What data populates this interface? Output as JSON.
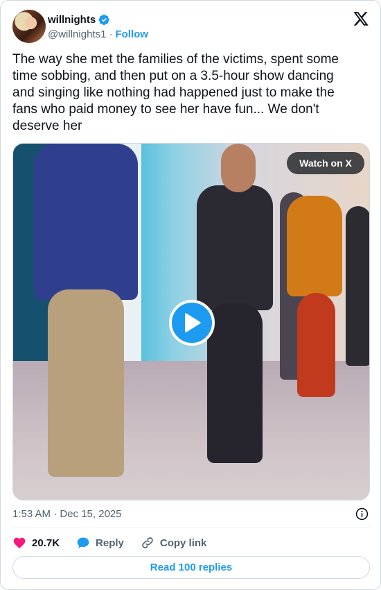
{
  "author": {
    "name": "willnights",
    "handle": "@willnights1",
    "separator": "·",
    "follow_label": "Follow"
  },
  "tweet": {
    "text": "The way she met the families of the victims, spent some time sobbing, and then put on a 3.5-hour show dancing and singing like nothing had happened just to make the fans who paid money to see her have fun... We don't deserve her",
    "timestamp": "1:53 AM · Dec 15, 2025"
  },
  "media": {
    "watch_label": "Watch on X",
    "play_icon": "play-icon"
  },
  "actions": {
    "likes_count": "20.7K",
    "reply_label": "Reply",
    "copy_link_label": "Copy link"
  },
  "read_replies_label": "Read 100 replies",
  "colors": {
    "accent": "#1d9bf0",
    "like": "#f91880",
    "text": "#0f1419",
    "muted": "#536471"
  }
}
